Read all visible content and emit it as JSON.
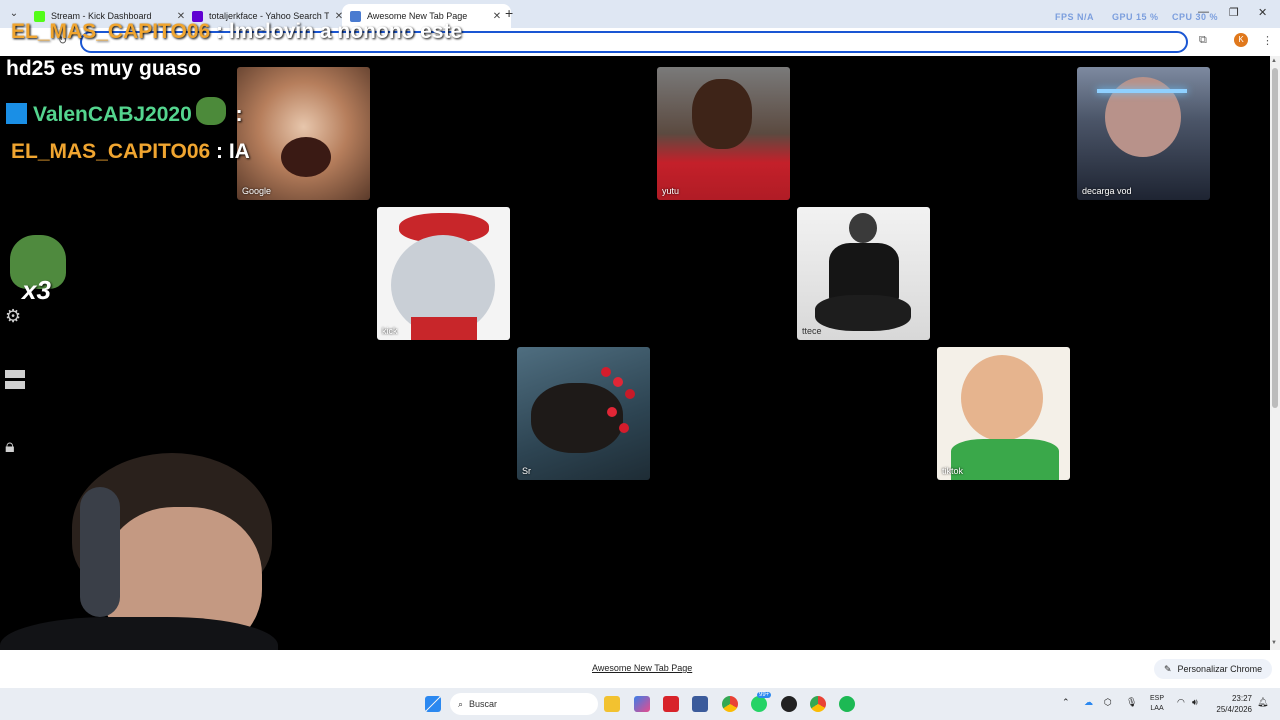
{
  "browser": {
    "tabs": [
      {
        "title": "Stream - Kick Dashboard",
        "favicon_color": "#53fc18"
      },
      {
        "title": "totaljerkface - Yahoo Search Tu",
        "favicon_color": "#6001d2"
      },
      {
        "title": "Awesome New Tab Page",
        "favicon_color": "#4a7bd0"
      }
    ],
    "new_tab_symbol": "+",
    "overlay_stats": {
      "fps": "FPS N/A",
      "gpu": "GPU 15 %",
      "cpu": "CPU 30 %"
    },
    "profile_initial": "K"
  },
  "chat": [
    {
      "user": "EL_MAS_CAPITO06",
      "sep": " : ",
      "msg": "lmclovin a nonono este"
    },
    {
      "user": "",
      "sep": "",
      "msg": "hd25 es muy guaso"
    },
    {
      "user": "ValenCABJ2020",
      "sep": " :",
      "msg": ""
    },
    {
      "user": "EL_MAS_CAPITO06",
      "sep": " : ",
      "msg": "IA"
    }
  ],
  "emote_counter": "x3",
  "tiles": [
    {
      "label": "Google",
      "colors": [
        "#d9b39a",
        "#8a5a40"
      ]
    },
    {
      "label": "yutu",
      "colors": [
        "#6e6e6e",
        "#c4202a"
      ]
    },
    {
      "label": "decarga vod",
      "colors": [
        "#6b7c93",
        "#1c2230"
      ]
    },
    {
      "label": "kick",
      "colors": [
        "#dcdcdc",
        "#c02a2a"
      ]
    },
    {
      "label": "ttece",
      "colors": [
        "#e8e8e8",
        "#1a1a1a"
      ]
    },
    {
      "label": "Sr",
      "colors": [
        "#3b5566",
        "#1b1b1b"
      ]
    },
    {
      "label": "tiktok",
      "colors": [
        "#f3efe8",
        "#3aa84a"
      ]
    }
  ],
  "footer": {
    "link": "Awesome New Tab Page",
    "customize": "Personalizar Chrome",
    "pencil": "✎"
  },
  "taskbar": {
    "search_placeholder": "Buscar",
    "lang_top": "ESP",
    "lang_bottom": "LAA",
    "time": "23:27",
    "date": "25/4/2026",
    "badge": "99+"
  }
}
